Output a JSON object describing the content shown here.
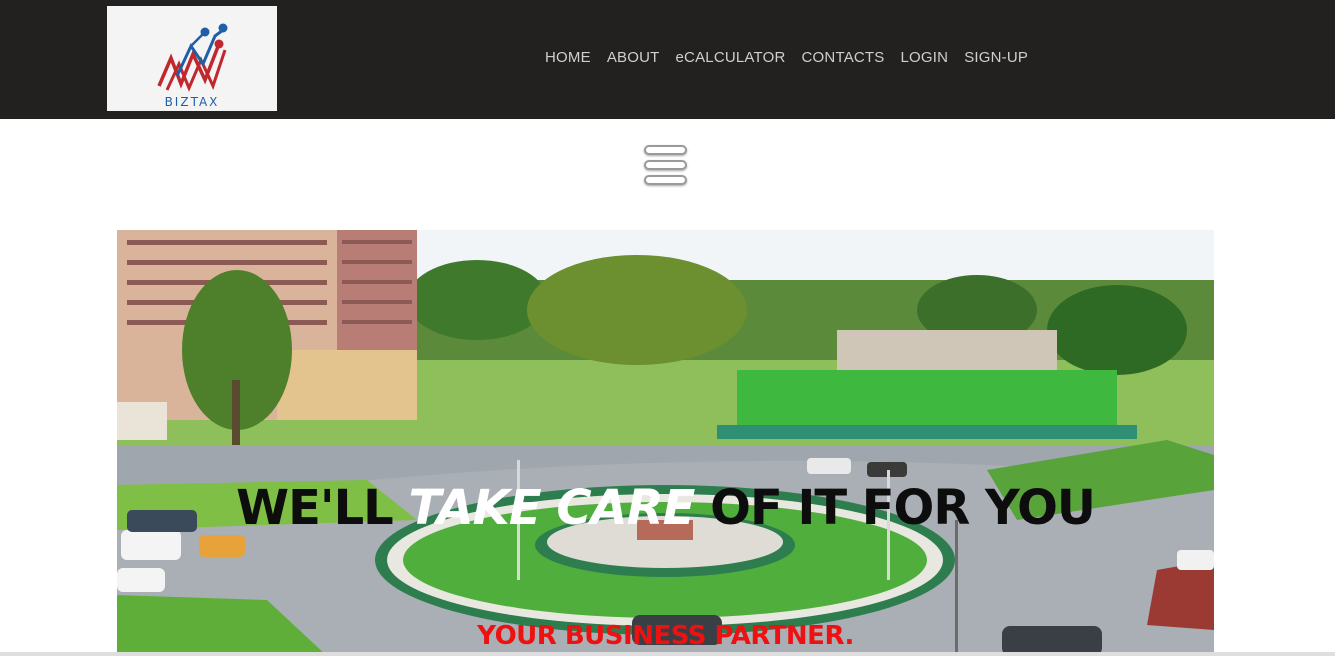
{
  "brand": {
    "logo_text": "BIZTAX"
  },
  "nav": {
    "items": [
      {
        "label": "HOME"
      },
      {
        "label": "ABOUT"
      },
      {
        "label": "eCALCULATOR"
      },
      {
        "label": "CONTACTS"
      },
      {
        "label": "LOGIN"
      },
      {
        "label": "SIGN-UP"
      }
    ]
  },
  "hero": {
    "headline_before": "WE'LL ",
    "headline_emphasis": "TAKE CARE",
    "headline_after": " OF IT FOR YOU",
    "tagline": "YOUR BUSINESS PARTNER."
  },
  "colors": {
    "header_bg": "#222120",
    "nav_text": "#cfcfcf",
    "tagline": "#ee1111",
    "logo_red": "#c0282d",
    "logo_blue": "#1f5fa8"
  }
}
